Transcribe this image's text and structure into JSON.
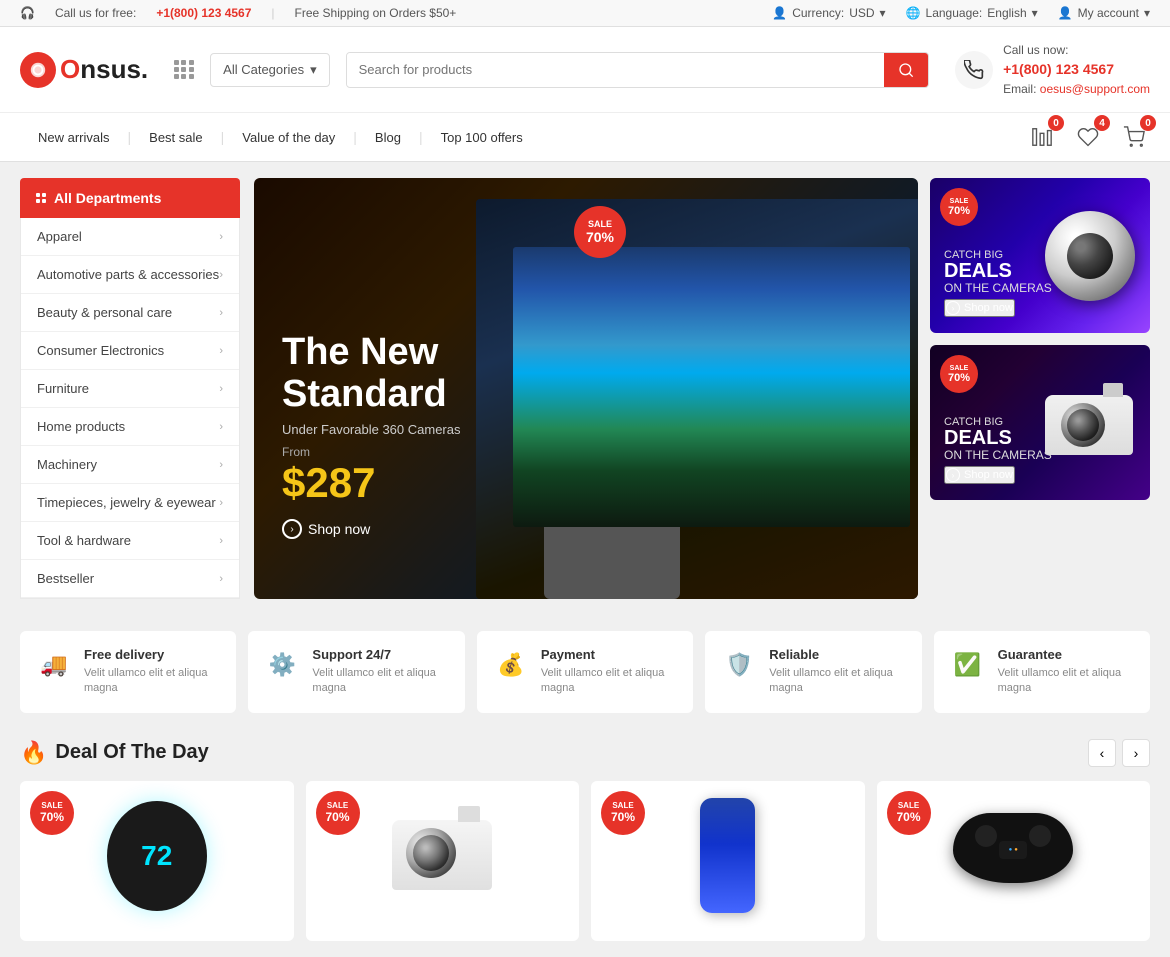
{
  "topBar": {
    "phone_label": "Call us for free:",
    "phone_number": "+1(800) 123 4567",
    "shipping": "Free Shipping on Orders $50+",
    "currency_label": "Currency:",
    "currency_value": "USD",
    "language_label": "Language:",
    "language_value": "English",
    "account_label": "My account"
  },
  "header": {
    "logo_text": "nsus.",
    "logo_prefix": "O",
    "category_label": "All Categories",
    "search_placeholder": "Search for products",
    "contact_call": "Call us now:",
    "contact_phone": "+1(800) 123 4567",
    "contact_email": "oesus@support.com"
  },
  "nav": {
    "links": [
      {
        "label": "New arrivals"
      },
      {
        "label": "Best sale"
      },
      {
        "label": "Value of the day"
      },
      {
        "label": "Blog"
      },
      {
        "label": "Top 100 offers"
      }
    ],
    "badges": [
      "0",
      "4",
      "0"
    ]
  },
  "sidebar": {
    "header_label": "All Departments",
    "items": [
      {
        "label": "Apparel"
      },
      {
        "label": "Automotive parts & accessories"
      },
      {
        "label": "Beauty & personal care"
      },
      {
        "label": "Consumer Electronics"
      },
      {
        "label": "Furniture"
      },
      {
        "label": "Home products"
      },
      {
        "label": "Machinery"
      },
      {
        "label": "Timepieces, jewelry & eyewear"
      },
      {
        "label": "Tool & hardware"
      },
      {
        "label": "Bestseller"
      }
    ]
  },
  "heroBanner": {
    "title_line1": "The New",
    "title_line2": "Standard",
    "subtitle": "Under Favorable 360 Cameras",
    "from_label": "From",
    "price": "$287",
    "shop_label": "Shop now",
    "sale_label": "SALE",
    "sale_pct": "70%"
  },
  "sideBanners": [
    {
      "sale_label": "SALE",
      "sale_pct": "70%",
      "catch": "CATCH BIG",
      "deals": "DEALS",
      "on_the": "ON THE CAMERAS",
      "shop": "Shop now"
    },
    {
      "sale_label": "SALE",
      "sale_pct": "70%",
      "catch": "CATCH BIG",
      "deals": "DEALS",
      "on_the": "ON THE CAMERAS",
      "shop": "Shop now"
    }
  ],
  "features": [
    {
      "icon": "🚚",
      "title": "Free delivery",
      "desc": "Velit ullamco elit et aliqua magna"
    },
    {
      "icon": "⚙️",
      "title": "Support 24/7",
      "desc": "Velit ullamco elit et aliqua magna"
    },
    {
      "icon": "💰",
      "title": "Payment",
      "desc": "Velit ullamco elit et aliqua magna"
    },
    {
      "icon": "🛡️",
      "title": "Reliable",
      "desc": "Velit ullamco elit et aliqua magna"
    },
    {
      "icon": "✅",
      "title": "Guarantee",
      "desc": "Velit ullamco elit et aliqua magna"
    }
  ],
  "dealSection": {
    "title": "Deal Of The Day",
    "products": [
      {
        "sale_label": "SALE",
        "sale_pct": "70%",
        "type": "thermostat",
        "temp": "72"
      },
      {
        "sale_label": "SALE",
        "sale_pct": "70%",
        "type": "camera"
      },
      {
        "sale_label": "SALE",
        "sale_pct": "70%",
        "type": "phone"
      },
      {
        "sale_label": "SALE",
        "sale_pct": "70%",
        "type": "gamepad"
      }
    ]
  }
}
